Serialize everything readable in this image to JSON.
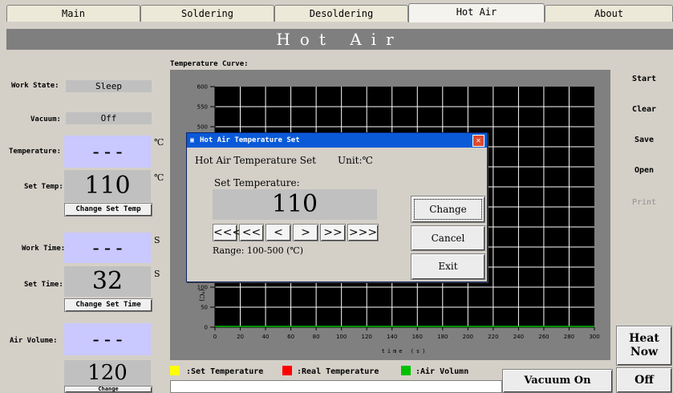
{
  "tabs": [
    {
      "label": "Main"
    },
    {
      "label": "Soldering"
    },
    {
      "label": "Desoldering"
    },
    {
      "label": "Hot Air"
    },
    {
      "label": "About"
    }
  ],
  "banner": {
    "title": "Hot Air"
  },
  "left": {
    "work_state_label": "Work State:",
    "work_state_value": "Sleep",
    "vacuum_label": "Vacuum:",
    "vacuum_value": "Off",
    "temperature_label": "Temperature:",
    "temperature_value": "---",
    "temperature_unit": "℃",
    "set_temp_label": "Set Temp:",
    "set_temp_value": "110",
    "set_temp_unit": "℃",
    "change_set_temp": "Change Set Temp",
    "work_time_label": "Work Time:",
    "work_time_value": "---",
    "work_time_unit": "S",
    "set_time_label": "Set Time:",
    "set_time_value": "32",
    "set_time_unit": "S",
    "change_set_time": "Change Set Time",
    "air_volume_label": "Air Volume:",
    "air_volume_value": "---",
    "air_set_value": "120",
    "change_air": "Change"
  },
  "right": {
    "start": "Start",
    "clear": "Clear",
    "save": "Save",
    "open": "Open",
    "print": "Print",
    "heat_now": "Heat Now",
    "off": "Off",
    "vacuum_on": "Vacuum On"
  },
  "chart_data": {
    "type": "line",
    "title": "Temperature Curve:",
    "xlabel": "time (s)",
    "ylabel": "(℃)",
    "xlim": [
      0,
      300
    ],
    "ylim": [
      0,
      600
    ],
    "x_ticks": [
      0,
      20,
      40,
      60,
      80,
      100,
      120,
      140,
      160,
      180,
      200,
      220,
      240,
      260,
      280,
      300
    ],
    "y_ticks": [
      0,
      50,
      100,
      500,
      550,
      600
    ],
    "grid": true,
    "series": [
      {
        "name": ":Set Temperature",
        "color": "#ffff00",
        "values": []
      },
      {
        "name": ":Real Temperature",
        "color": "#ff0000",
        "values": []
      },
      {
        "name": ":Air Volumn",
        "color": "#00c000",
        "values": []
      }
    ]
  },
  "dialog": {
    "title": "Hot Air Temperature Set",
    "heading": "Hot Air Temperature Set",
    "unit": "Unit:℃",
    "set_label": "Set Temperature:",
    "value": "110",
    "arrows": [
      "<<<",
      "<<",
      "<",
      ">",
      ">>",
      ">>>"
    ],
    "range": "Range: 100-500  (℃)",
    "change": "Change",
    "cancel": "Cancel",
    "exit": "Exit"
  }
}
